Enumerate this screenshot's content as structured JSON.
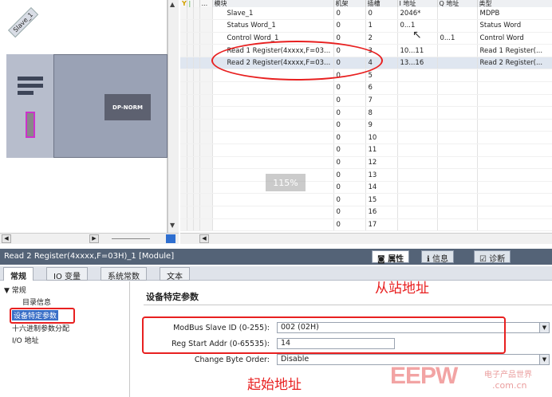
{
  "device_view": {
    "slave_label": "Slave_1",
    "dp_label": "DP-NORM"
  },
  "table": {
    "headers": [
      "模块",
      "机架",
      "插槽",
      "I 地址",
      "Q 地址",
      "类型"
    ],
    "rows": [
      {
        "module": "Slave_1",
        "rack": "0",
        "slot": "0",
        "i": "2046*",
        "q": "",
        "type": "MDPB"
      },
      {
        "module": "Status Word_1",
        "rack": "0",
        "slot": "1",
        "i": "0...1",
        "q": "",
        "type": "Status Word"
      },
      {
        "module": "Control Word_1",
        "rack": "0",
        "slot": "2",
        "i": "",
        "q": "0...1",
        "type": "Control Word"
      },
      {
        "module": "Read 1 Register(4xxxx,F=03...",
        "rack": "0",
        "slot": "3",
        "i": "10...11",
        "q": "",
        "type": "Read 1 Register(..."
      },
      {
        "module": "Read 2 Register(4xxxx,F=03...",
        "rack": "0",
        "slot": "4",
        "i": "13...16",
        "q": "",
        "type": "Read 2 Register(..."
      },
      {
        "module": "",
        "rack": "0",
        "slot": "5",
        "i": "",
        "q": "",
        "type": ""
      },
      {
        "module": "",
        "rack": "0",
        "slot": "6",
        "i": "",
        "q": "",
        "type": ""
      },
      {
        "module": "",
        "rack": "0",
        "slot": "7",
        "i": "",
        "q": "",
        "type": ""
      },
      {
        "module": "",
        "rack": "0",
        "slot": "8",
        "i": "",
        "q": "",
        "type": ""
      },
      {
        "module": "",
        "rack": "0",
        "slot": "9",
        "i": "",
        "q": "",
        "type": ""
      },
      {
        "module": "",
        "rack": "0",
        "slot": "10",
        "i": "",
        "q": "",
        "type": ""
      },
      {
        "module": "",
        "rack": "0",
        "slot": "11",
        "i": "",
        "q": "",
        "type": ""
      },
      {
        "module": "",
        "rack": "0",
        "slot": "12",
        "i": "",
        "q": "",
        "type": ""
      },
      {
        "module": "",
        "rack": "0",
        "slot": "13",
        "i": "",
        "q": "",
        "type": ""
      },
      {
        "module": "",
        "rack": "0",
        "slot": "14",
        "i": "",
        "q": "",
        "type": ""
      },
      {
        "module": "",
        "rack": "0",
        "slot": "15",
        "i": "",
        "q": "",
        "type": ""
      },
      {
        "module": "",
        "rack": "0",
        "slot": "16",
        "i": "",
        "q": "",
        "type": ""
      },
      {
        "module": "",
        "rack": "0",
        "slot": "17",
        "i": "",
        "q": "",
        "type": ""
      }
    ],
    "zoom": "115%",
    "highlight_row": 4
  },
  "properties": {
    "title": "Read 2 Register(4xxxx,F=03H)_1 [Module]",
    "title_tabs": [
      "属性",
      "信息",
      "诊断"
    ],
    "sub_tabs": [
      "常规",
      "IO 变量",
      "系统常数",
      "文本"
    ],
    "nav": {
      "root": "常规",
      "items": [
        "目录信息",
        "设备特定参数",
        "十六进制参数分配",
        "I/O 地址"
      ]
    },
    "section_title": "设备特定参数",
    "fields": {
      "slave_id_label": "ModBus Slave ID (0-255):",
      "slave_id_value": "002 (02H)",
      "start_addr_label": "Reg Start Addr (0-65535):",
      "start_addr_value": "14",
      "byte_order_label": "Change Byte Order:",
      "byte_order_value": "Disable"
    }
  },
  "annotations": {
    "slave_addr": "从站地址",
    "start_addr": "起始地址"
  },
  "watermark": {
    "logo": "EEPW",
    "line1": "电子产品世界",
    "line2": ".com.cn"
  },
  "colors": {
    "annotation_red": "#e82020",
    "title_bar": "#546377",
    "selection_blue": "#3a6fc7"
  }
}
